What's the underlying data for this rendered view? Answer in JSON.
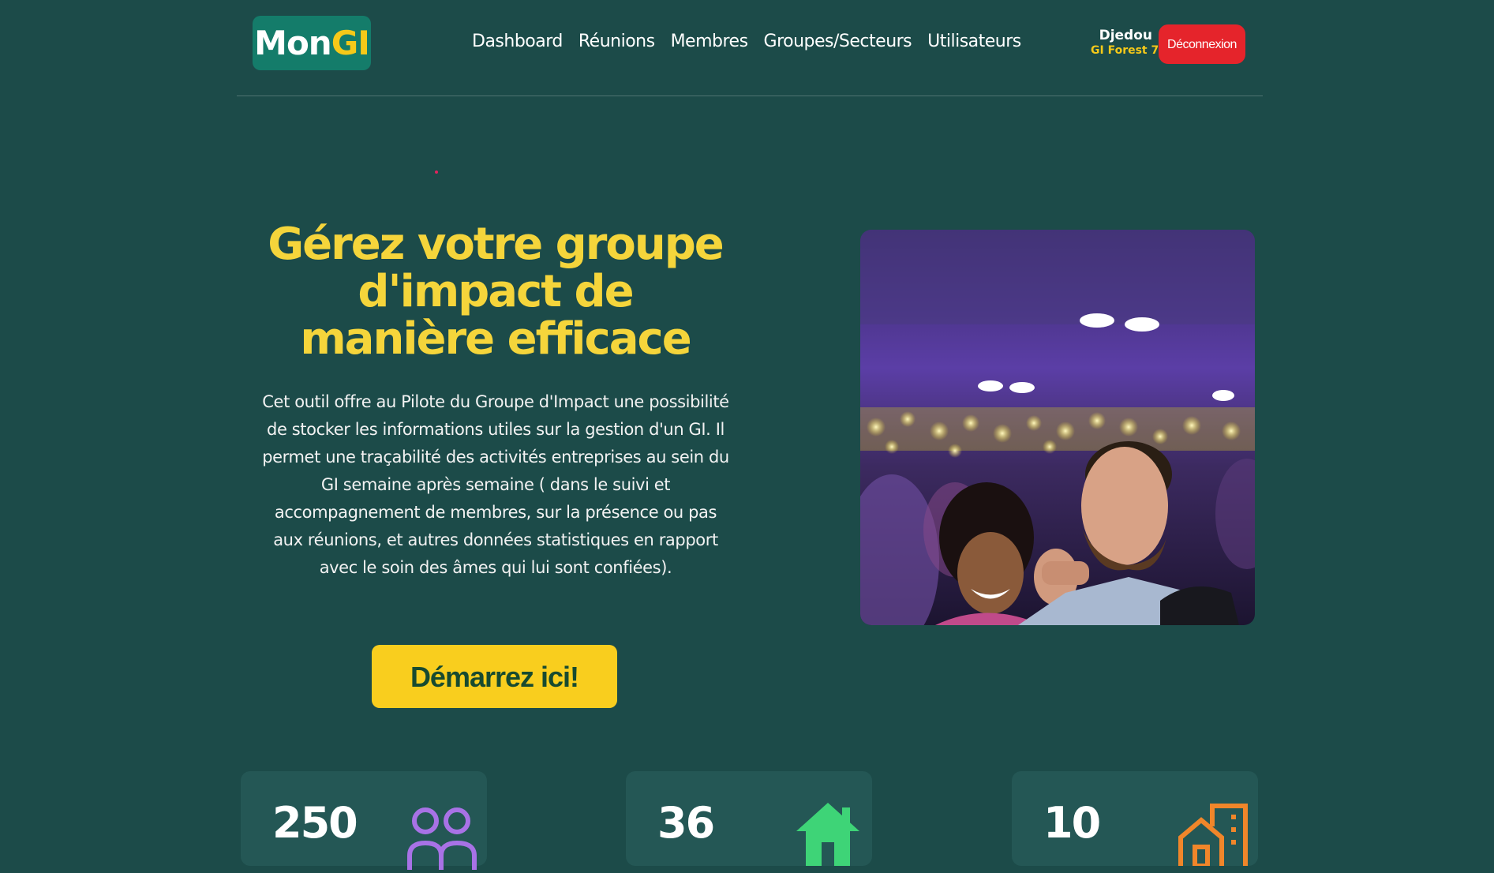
{
  "header": {
    "logo": {
      "part1": "Mon",
      "part2": "GI"
    },
    "nav": [
      {
        "label": "Dashboard"
      },
      {
        "label": "Réunions"
      },
      {
        "label": "Membres"
      },
      {
        "label": "Groupes/Secteurs"
      },
      {
        "label": "Utilisateurs"
      }
    ],
    "user": {
      "name": "Djedou",
      "group": "GI Forest 7"
    },
    "logout_label": "Déconnexion"
  },
  "hero": {
    "title": "Gérez votre groupe d'impact de manière efficace",
    "description": "Cet outil offre au Pilote du Groupe d'Impact une possibilité de stocker les informations utiles sur la gestion d'un GI. Il permet une traçabilité des activités entreprises au sein du GI semaine après semaine ( dans le suivi et accompagnement de membres, sur la présence ou pas aux réunions, et autres données statistiques en rapport avec le soin des âmes qui lui sont confiées).",
    "cta_label": "Démarrez ici!"
  },
  "stats": [
    {
      "value": "250",
      "icon": "users-icon",
      "color": "#a872e6"
    },
    {
      "value": "36",
      "icon": "home-icon",
      "color": "#3ed477"
    },
    {
      "value": "10",
      "icon": "building-icon",
      "color": "#f0862a"
    }
  ],
  "colors": {
    "background": "#1c4b49",
    "accent_yellow": "#f5c919",
    "logout_red": "#e5242b",
    "logo_green": "#147c6a"
  }
}
